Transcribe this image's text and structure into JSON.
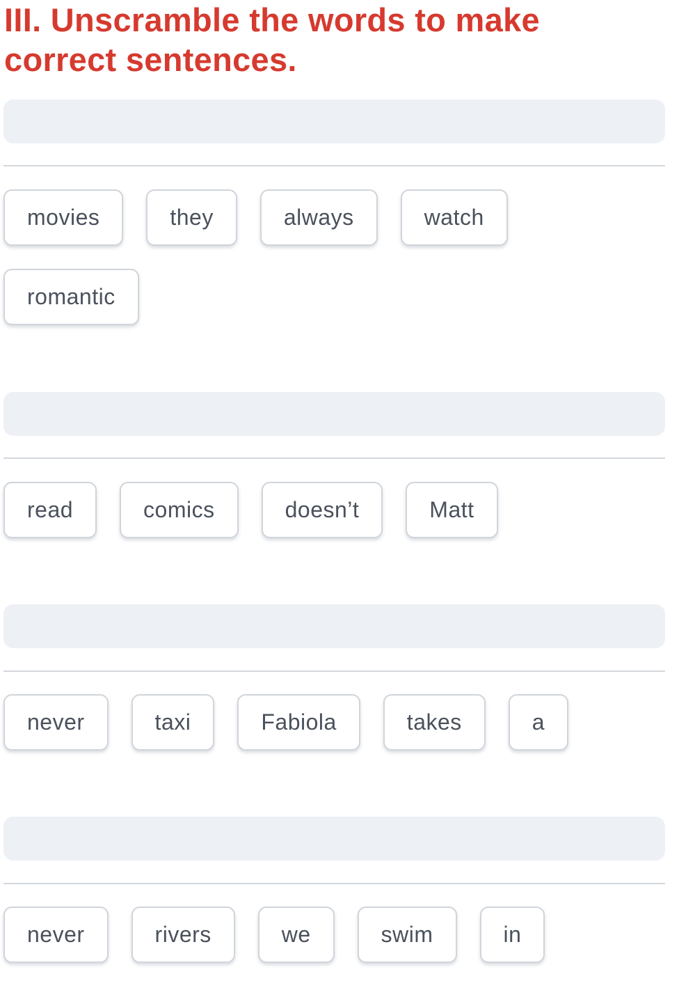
{
  "title_line1": "III. Unscramble the words to make",
  "title_line2": "correct sentences.",
  "exercises": [
    {
      "answer": "",
      "words": [
        "movies",
        "they",
        "always",
        "watch",
        "romantic"
      ]
    },
    {
      "answer": "",
      "words": [
        "read",
        "comics",
        "doesn’t",
        "Matt"
      ]
    },
    {
      "answer": "",
      "words": [
        "never",
        "taxi",
        "Fabiola",
        "takes",
        "a"
      ]
    },
    {
      "answer": "",
      "words": [
        "never",
        "rivers",
        "we",
        "swim",
        "in"
      ]
    }
  ],
  "colors": {
    "title": "#d63a2f",
    "dropzone": "#edf0f4",
    "chip_text": "#4a515c",
    "chip_border": "#d0d5db"
  }
}
